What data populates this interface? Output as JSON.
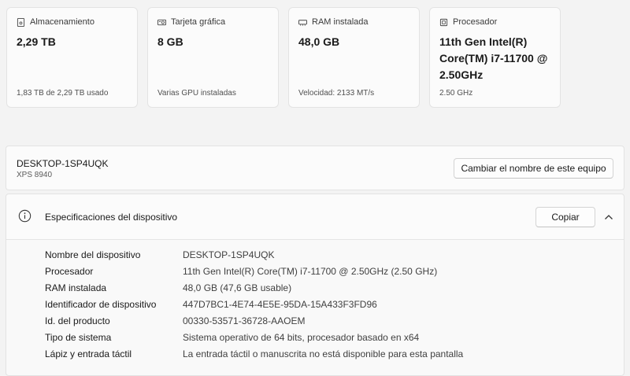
{
  "cards": [
    {
      "icon": "storage-icon",
      "title": "Almacenamiento",
      "value": "2,29 TB",
      "sub": "1,83 TB de 2,29 TB usado"
    },
    {
      "icon": "gpu-icon",
      "title": "Tarjeta gráfica",
      "value": "8 GB",
      "sub": "Varias GPU instaladas"
    },
    {
      "icon": "ram-icon",
      "title": "RAM instalada",
      "value": "48,0 GB",
      "sub": "Velocidad: 2133 MT/s"
    },
    {
      "icon": "processor-icon",
      "title": "Procesador",
      "value": "11th Gen Intel(R) Core(TM) i7-11700 @ 2.50GHz",
      "sub": "2.50 GHz"
    }
  ],
  "device": {
    "name": "DESKTOP-1SP4UQK",
    "model": "XPS 8940",
    "rename_label": "Cambiar el nombre de este equipo"
  },
  "specs": {
    "title": "Especificaciones del dispositivo",
    "copy_label": "Copiar",
    "rows": [
      {
        "label": "Nombre del dispositivo",
        "value": "DESKTOP-1SP4UQK"
      },
      {
        "label": "Procesador",
        "value": "11th Gen Intel(R) Core(TM) i7-11700 @ 2.50GHz (2.50 GHz)"
      },
      {
        "label": "RAM instalada",
        "value": "48,0 GB (47,6 GB usable)"
      },
      {
        "label": "Identificador de dispositivo",
        "value": "447D7BC1-4E74-4E5E-95DA-15A433F3FD96"
      },
      {
        "label": "Id. del producto",
        "value": "00330-53571-36728-AAOEM"
      },
      {
        "label": "Tipo de sistema",
        "value": "Sistema operativo de 64 bits, procesador basado en x64"
      },
      {
        "label": "Lápiz y entrada táctil",
        "value": "La entrada táctil o manuscrita no está disponible para esta pantalla"
      }
    ]
  }
}
